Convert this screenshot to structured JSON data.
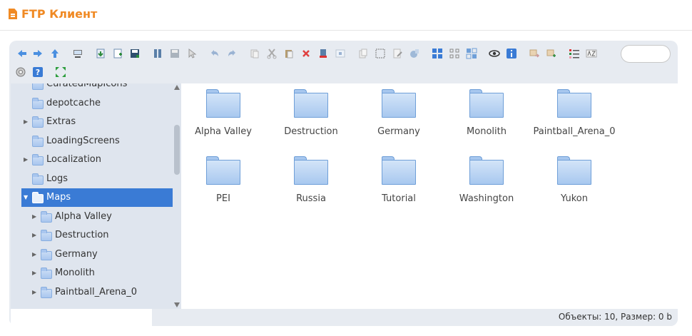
{
  "app": {
    "title": "FTP Клиент"
  },
  "toolbar": {
    "buttons": [
      "back-icon",
      "forward-icon",
      "up-icon",
      "netmount-icon",
      "download-icon",
      "upload-icon",
      "save-icon",
      "open-icon",
      "save-disk-icon",
      "select-icon",
      "undo-icon",
      "redo-icon",
      "copy-icon",
      "cut-icon",
      "paste-icon",
      "delete-icon",
      "empty-icon",
      "resize-icon",
      "duplicate-icon",
      "selectall-icon",
      "rename-icon",
      "archive-icon",
      "view-icons-icon",
      "view-small-icons-icon",
      "view-tiles-icon",
      "preview-icon",
      "info-icon",
      "extract-icon",
      "compress-icon",
      "sort-icon",
      "fullname-icon",
      "settings-icon",
      "help-icon",
      "fullscreen-icon"
    ],
    "search_placeholder": ""
  },
  "tree": {
    "items": [
      {
        "label": "CuratedMapIcons",
        "level": 0,
        "expandable": false
      },
      {
        "label": "depotcache",
        "level": 0,
        "expandable": false
      },
      {
        "label": "Extras",
        "level": 0,
        "expandable": true
      },
      {
        "label": "LoadingScreens",
        "level": 0,
        "expandable": false
      },
      {
        "label": "Localization",
        "level": 0,
        "expandable": true
      },
      {
        "label": "Logs",
        "level": 0,
        "expandable": false
      },
      {
        "label": "Maps",
        "level": 0,
        "expandable": true,
        "selected": true
      },
      {
        "label": "Alpha Valley",
        "level": 1,
        "expandable": true
      },
      {
        "label": "Destruction",
        "level": 1,
        "expandable": true
      },
      {
        "label": "Germany",
        "level": 1,
        "expandable": true
      },
      {
        "label": "Monolith",
        "level": 1,
        "expandable": true
      },
      {
        "label": "Paintball_Arena_0",
        "level": 1,
        "expandable": true
      }
    ]
  },
  "files": [
    {
      "name": "Alpha Valley"
    },
    {
      "name": "Destruction"
    },
    {
      "name": "Germany"
    },
    {
      "name": "Monolith"
    },
    {
      "name": "Paintball_Arena_0"
    },
    {
      "name": "PEI"
    },
    {
      "name": "Russia"
    },
    {
      "name": "Tutorial"
    },
    {
      "name": "Washington"
    },
    {
      "name": "Yukon"
    }
  ],
  "status": {
    "text": "Объекты: 10, Размер: 0 b"
  },
  "colors": {
    "accent": "#f08a24",
    "selection": "#3a7bd5",
    "folder": "#a8c8ef"
  }
}
